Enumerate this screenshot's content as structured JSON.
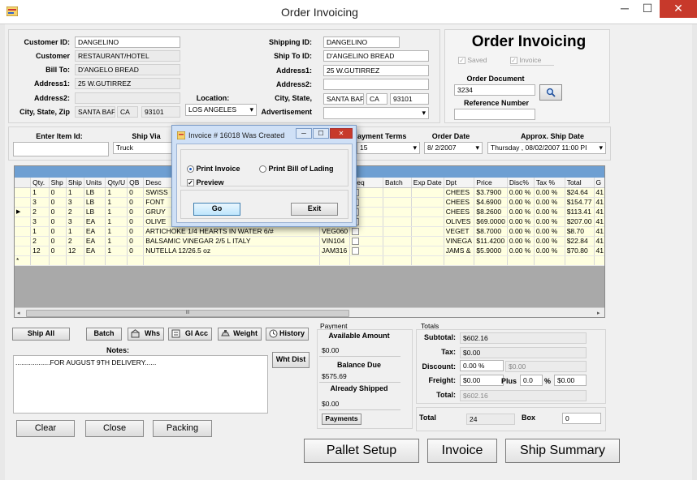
{
  "window": {
    "title": "Order Invoicing",
    "minimize": "─",
    "maximize": "☐",
    "close": "✕"
  },
  "customer": {
    "labels": {
      "id": "Customer ID:",
      "customer": "Customer",
      "bill_to": "Bill To:",
      "address1": "Address1:",
      "address2": "Address2:",
      "csz": "City, State, Zip"
    },
    "id": "DANGELINO",
    "customer": "RESTAURANT/HOTEL",
    "bill_to": "D'ANGELO BREAD",
    "address1": "25 W.GUTIRREZ",
    "address2": "",
    "city": "SANTA BAF",
    "state": "CA",
    "zip": "93101"
  },
  "location": {
    "label": "Location:",
    "value": "LOS ANGELES"
  },
  "shipping": {
    "labels": {
      "id": "Shipping ID:",
      "ship_to_id": "Ship To ID:",
      "address1": "Address1:",
      "address2": "Address2:",
      "city_state": "City, State,",
      "advertisement": "Advertisement"
    },
    "id": "DANGELINO",
    "ship_to_id": "D'ANGELINO BREAD",
    "address1": "25 W.GUTIRREZ",
    "address2": "",
    "city": "SANTA BAF",
    "state": "CA",
    "zip": "93101",
    "advertisement": ""
  },
  "invoice_box": {
    "heading": "Order Invoicing",
    "saved": "Saved",
    "invoice": "Invoice",
    "order_document_label": "Order Document",
    "order_document": "3234",
    "reference_label": "Reference Number",
    "reference": ""
  },
  "entry": {
    "item_id_label": "Enter Item Id:",
    "item_id": "",
    "ship_via_label": "Ship Via",
    "ship_via": "Truck",
    "payment_terms_label": "ayment Terms",
    "payment_terms": "15",
    "order_date_label": "Order Date",
    "order_date": "8/ 2/2007",
    "ship_date_label": "Approx. Ship  Date",
    "ship_date": "Thursday , 08/02/2007 11:00 PI"
  },
  "grid": {
    "columns": [
      "Qty.",
      "Shp",
      "Ship",
      "Units",
      "Qty/U",
      "QB",
      "Desc",
      "",
      "Req",
      "Batch",
      "Exp Date",
      "Dpt",
      "Price",
      "Disc%",
      "Tax %",
      "Total",
      "G"
    ],
    "rows": [
      [
        "1",
        "0",
        "1",
        "LB",
        "1",
        "0",
        "SWISS",
        "",
        "",
        "",
        "",
        "CHEES",
        "$3.7900",
        "0.00 %",
        "0.00 %",
        "$24.64",
        "41"
      ],
      [
        "3",
        "0",
        "3",
        "LB",
        "1",
        "0",
        "FONT",
        "",
        "",
        "",
        "",
        "CHEES",
        "$4.6900",
        "0.00 %",
        "0.00 %",
        "$154.77",
        "41"
      ],
      [
        "2",
        "0",
        "2",
        "LB",
        "1",
        "0",
        "GRUY",
        "",
        "",
        "",
        "",
        "CHEES",
        "$8.2600",
        "0.00 %",
        "0.00 %",
        "$113.41",
        "41"
      ],
      [
        "3",
        "0",
        "3",
        "EA",
        "1",
        "0",
        "OLIVE",
        "",
        "",
        "",
        "",
        "OLIVES",
        "$69.0000",
        "0.00 %",
        "0.00 %",
        "$207.00",
        "41"
      ],
      [
        "1",
        "0",
        "1",
        "EA",
        "1",
        "0",
        "ARTICHOKE 1/4 HEARTS IN WATER 6/#",
        "VEG060",
        "",
        "",
        "",
        "VEGET",
        "$8.7000",
        "0.00 %",
        "0.00 %",
        "$8.70",
        "41"
      ],
      [
        "2",
        "0",
        "2",
        "EA",
        "1",
        "0",
        "BALSAMIC VINEGAR 2/5 L ITALY",
        "VIN104",
        "",
        "",
        "",
        "VINEGA",
        "$11.4200",
        "0.00 %",
        "0.00 %",
        "$22.84",
        "41"
      ],
      [
        "12",
        "0",
        "12",
        "EA",
        "1",
        "0",
        "NUTELLA 12/26.5 oz",
        "JAM316",
        "",
        "",
        "",
        "JAMS &",
        "$5.9000",
        "0.00 %",
        "0.00 %",
        "$70.80",
        "41"
      ]
    ],
    "selected_row_marker": "▶",
    "new_row_marker": "*",
    "scroll_grip": "III"
  },
  "toolbar": {
    "ship_all": "Ship All",
    "batch": "Batch",
    "whs": "Whs",
    "gl_acc": "Gl Acc",
    "weight": "Weight",
    "history": "History"
  },
  "notes": {
    "label": "Notes:",
    "value": "..................FOR AUGUST 9TH DELIVERY......"
  },
  "wht_dist": "Wht Dist",
  "payment": {
    "heading": "Payment",
    "available_label": "Available Amount",
    "available": "$0.00",
    "balance_label": "Balance Due",
    "balance": "$575.69",
    "shipped_label": "Already Shipped",
    "shipped": "$0.00",
    "payments_button": "Payments"
  },
  "totals": {
    "heading": "Totals",
    "subtotal_label": "Subtotal:",
    "subtotal": "$602.16",
    "tax_label": "Tax:",
    "tax": "$0.00",
    "discount_label": "Discount:",
    "discount_pct": "0.00 %",
    "discount_amt": "$0.00",
    "freight_label": "Freight:",
    "freight": "$0.00",
    "plus_label": "Plus",
    "plus": "0.0",
    "pct": "%",
    "plus_amt": "$0.00",
    "total_label": "Total:",
    "total": "$602.16",
    "count_label": "Total",
    "count": "24",
    "box_label": "Box",
    "box": "0"
  },
  "bottom_buttons": {
    "clear": "Clear",
    "close": "Close",
    "packing": "Packing",
    "pallet_setup": "Pallet Setup",
    "invoice": "Invoice",
    "ship_summary": "Ship Summary"
  },
  "dialog": {
    "title": "Invoice # 16018 Was Created",
    "print_invoice": "Print Invoice",
    "print_bol": "Print Bill of Lading",
    "preview": "Preview",
    "go": "Go",
    "exit": "Exit"
  }
}
